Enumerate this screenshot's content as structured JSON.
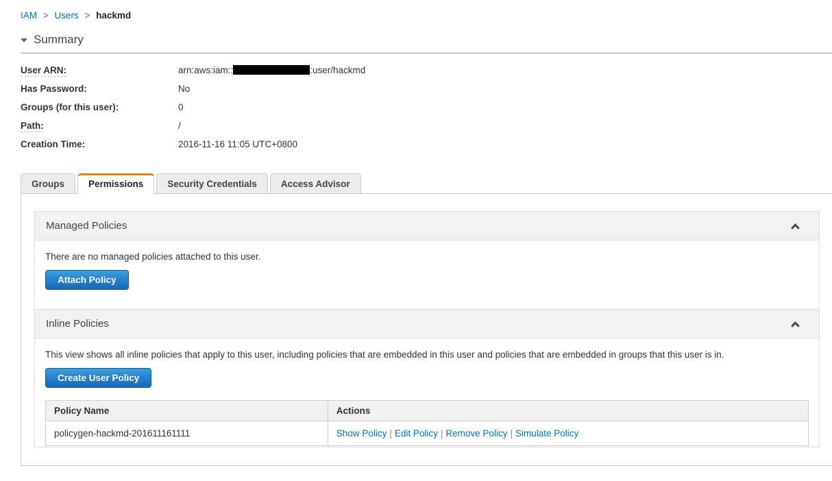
{
  "colors": {
    "link_blue": "#0073bb",
    "tab_accent_orange": "#ec7f0c",
    "button_blue_top": "#3b9de0",
    "button_blue_bottom": "#1468b8",
    "section_header_bg": "#f2f2f2"
  },
  "breadcrumb": {
    "separator": ">",
    "items": [
      {
        "label": "IAM"
      },
      {
        "label": "Users"
      },
      {
        "label": "hackmd"
      }
    ]
  },
  "summary": {
    "title": "Summary",
    "user_arn": {
      "label": "User ARN:",
      "prefix": "arn:aws:iam::",
      "suffix": ":user/hackmd"
    },
    "has_password": {
      "label": "Has Password:",
      "value": "No"
    },
    "groups": {
      "label": "Groups (for this user):",
      "value": "0"
    },
    "path": {
      "label": "Path:",
      "value": "/"
    },
    "creation_time": {
      "label": "Creation Time:",
      "value": "2016-11-16 11:05 UTC+0800"
    }
  },
  "tabs": [
    {
      "label": "Groups",
      "active": false
    },
    {
      "label": "Permissions",
      "active": true
    },
    {
      "label": "Security Credentials",
      "active": false
    },
    {
      "label": "Access Advisor",
      "active": false
    }
  ],
  "managed_policies": {
    "title": "Managed Policies",
    "empty_message": "There are no managed policies attached to this user.",
    "attach_button": "Attach Policy"
  },
  "inline_policies": {
    "title": "Inline Policies",
    "description": "This view shows all inline policies that apply to this user, including policies that are embedded in this user and policies that are embedded in groups that this user is in.",
    "create_button": "Create User Policy",
    "actions_separator": "|",
    "table": {
      "headers": [
        "Policy Name",
        "Actions"
      ],
      "rows": [
        {
          "policy_name": "policygen-hackmd-201611161111",
          "actions": [
            "Show Policy",
            "Edit Policy",
            "Remove Policy",
            "Simulate Policy"
          ]
        }
      ]
    }
  }
}
